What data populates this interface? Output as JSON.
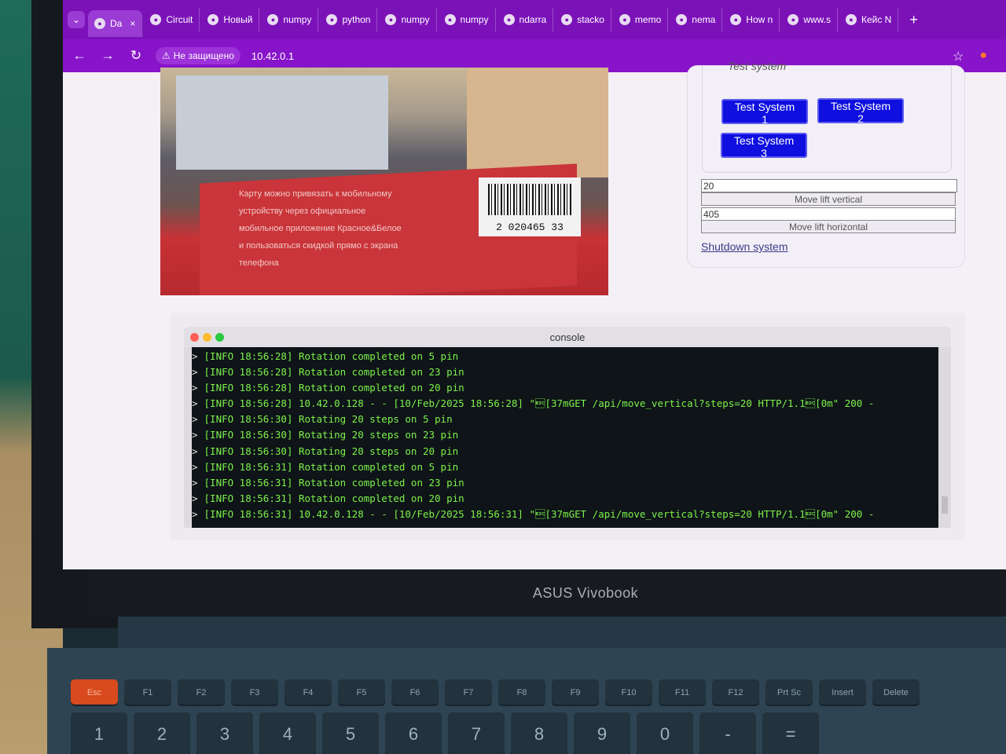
{
  "browser": {
    "tabs": [
      {
        "label": "Da",
        "icon": "globe-icon",
        "active": true
      },
      {
        "label": "Circuit",
        "icon": "circuit-icon",
        "active": false
      },
      {
        "label": "Новый",
        "icon": "doc-icon",
        "active": false
      },
      {
        "label": "numpy",
        "icon": "google-icon",
        "active": false
      },
      {
        "label": "python",
        "icon": "python-icon",
        "active": false
      },
      {
        "label": "numpy",
        "icon": "ai-icon",
        "active": false
      },
      {
        "label": "numpy",
        "icon": "ai-icon",
        "active": false
      },
      {
        "label": "ndarra",
        "icon": "google-icon",
        "active": false
      },
      {
        "label": "stacko",
        "icon": "stackoverflow-icon",
        "active": false
      },
      {
        "label": "memo",
        "icon": "python-icon",
        "active": false
      },
      {
        "label": "nema",
        "icon": "google-icon",
        "active": false
      },
      {
        "label": "How n",
        "icon": "ai-icon",
        "active": false
      },
      {
        "label": "www.s",
        "icon": "ai-icon",
        "active": false
      },
      {
        "label": "Кейс N",
        "icon": "doc-icon",
        "active": false
      }
    ],
    "security_label": "Не защищено",
    "url": "10.42.0.1"
  },
  "control_panel": {
    "heading": "Test system",
    "buttons": {
      "test1": "Test System 1",
      "test2": "Test System 2",
      "test3": "Test System 3"
    },
    "vertical_value": "20",
    "vertical_button": "Move lift vertical",
    "horizontal_value": "405",
    "horizontal_button": "Move lift horizontal",
    "shutdown_link": "Shutdown system"
  },
  "camera": {
    "text_lines": [
      "Карту можно привязать к мобильному",
      "устройству через официальное",
      "мобильное приложение Красное&Белое",
      "и пользоваться скидкой прямо с экрана",
      "телефона"
    ],
    "barcode": "2 020465 33"
  },
  "console": {
    "title": "console",
    "lines": [
      "[INFO 18:56:28] Rotation completed on 5 pin",
      "[INFO 18:56:28] Rotation completed on 23 pin",
      "[INFO 18:56:28] Rotation completed on 20 pin",
      "[INFO 18:56:28] 10.42.0.128 - - [10/Feb/2025 18:56:28] \"\u001b[37mGET /api/move_vertical?steps=20 HTTP/1.1\u001b[0m\" 200 -",
      "[INFO 18:56:30] Rotating 20 steps on 5 pin",
      "[INFO 18:56:30] Rotating 20 steps on 23 pin",
      "[INFO 18:56:30] Rotating 20 steps on 20 pin",
      "[INFO 18:56:31] Rotation completed on 5 pin",
      "[INFO 18:56:31] Rotation completed on 23 pin",
      "[INFO 18:56:31] Rotation completed on 20 pin",
      "[INFO 18:56:31] 10.42.0.128 - - [10/Feb/2025 18:56:31] \"\u001b[37mGET /api/move_vertical?steps=20 HTTP/1.1\u001b[0m\" 200 -"
    ],
    "prompt": ">"
  },
  "laptop": {
    "brand": "ASUS Vivobook",
    "fn_keys": [
      "Esc",
      "F1",
      "F2",
      "F3",
      "F4",
      "F5",
      "F6",
      "F7",
      "F8",
      "F9",
      "F10",
      "F11",
      "F12",
      "Prt Sc",
      "Insert",
      "Delete"
    ],
    "num_keys": [
      "1",
      "2",
      "3",
      "4",
      "5",
      "6",
      "7",
      "8",
      "9",
      "0",
      "-",
      "="
    ]
  },
  "colors": {
    "tabstrip": "#7b12b8",
    "toolbar": "#8814c9",
    "button_blue": "#0f0fe0",
    "console_green": "#7df24a"
  }
}
